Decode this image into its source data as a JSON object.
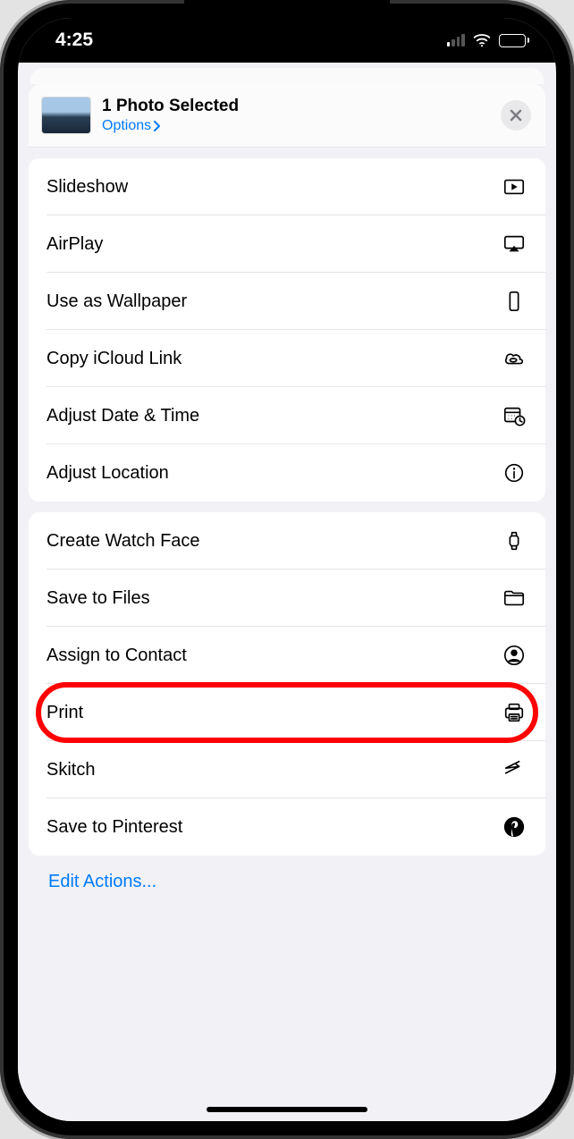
{
  "status": {
    "time": "4:25"
  },
  "header": {
    "title": "1 Photo Selected",
    "options_label": "Options"
  },
  "groups": [
    {
      "items": [
        {
          "id": "slideshow",
          "label": "Slideshow",
          "icon": "play-rect-icon"
        },
        {
          "id": "airplay",
          "label": "AirPlay",
          "icon": "airplay-icon"
        },
        {
          "id": "wallpaper",
          "label": "Use as Wallpaper",
          "icon": "phone-icon"
        },
        {
          "id": "copy-icloud",
          "label": "Copy iCloud Link",
          "icon": "cloud-link-icon"
        },
        {
          "id": "adjust-date",
          "label": "Adjust Date & Time",
          "icon": "calendar-clock-icon"
        },
        {
          "id": "adjust-location",
          "label": "Adjust Location",
          "icon": "info-icon"
        }
      ]
    },
    {
      "items": [
        {
          "id": "watch-face",
          "label": "Create Watch Face",
          "icon": "watch-icon"
        },
        {
          "id": "save-files",
          "label": "Save to Files",
          "icon": "folder-icon"
        },
        {
          "id": "assign-contact",
          "label": "Assign to Contact",
          "icon": "contact-icon"
        },
        {
          "id": "print",
          "label": "Print",
          "icon": "printer-icon",
          "highlight": true
        },
        {
          "id": "skitch",
          "label": "Skitch",
          "icon": "skitch-icon"
        },
        {
          "id": "pinterest",
          "label": "Save to Pinterest",
          "icon": "pinterest-icon"
        }
      ]
    }
  ],
  "edit_actions_label": "Edit Actions..."
}
